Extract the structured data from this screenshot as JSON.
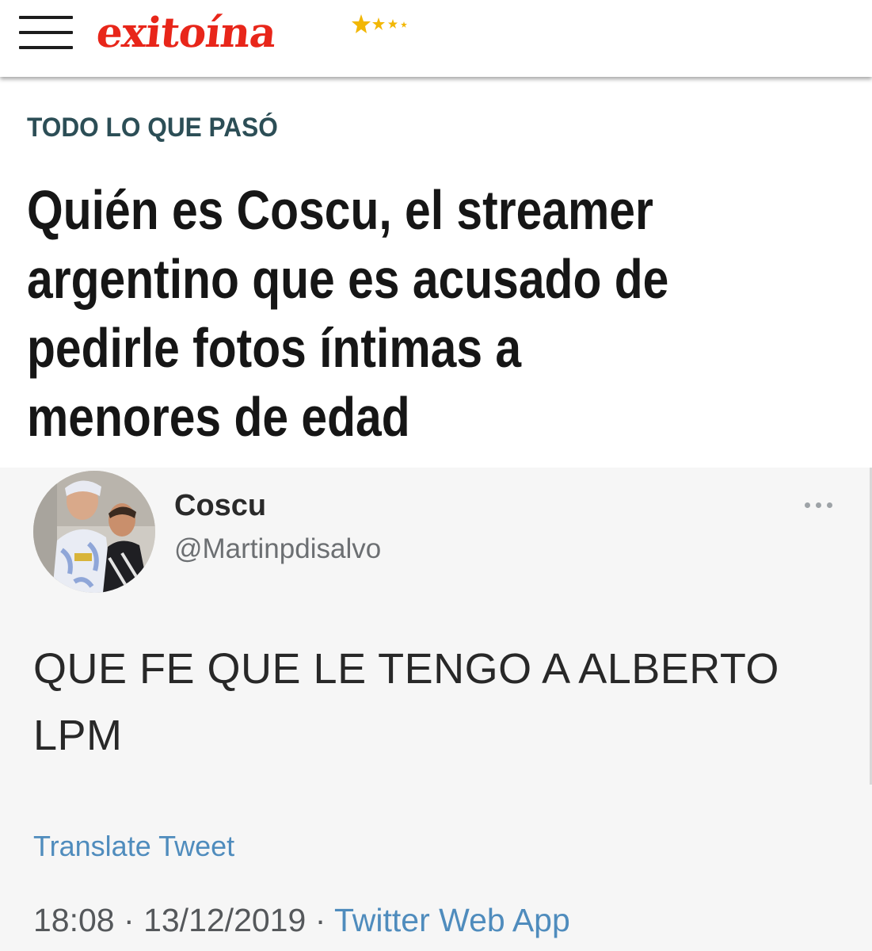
{
  "header": {
    "logo_text": "exitoína",
    "brand_color": "#e8261a",
    "star_color": "#f2b705",
    "menu_icon": "hamburger-menu-icon"
  },
  "article": {
    "kicker": "TODO LO QUE PASÓ",
    "kicker_color": "#2c4e56",
    "headline_lines": [
      "Quién es Coscu, el streamer",
      "argentino que es acusado de",
      "pedirle fotos íntimas a",
      "menores de edad"
    ]
  },
  "tweet": {
    "display_name": "Coscu",
    "handle": "@Martinpdisalvo",
    "more_icon": "more-options-icon",
    "text_lines": [
      "QUE FE QUE LE TENGO A ALBERTO",
      "LPM"
    ],
    "translate_label": "Translate Tweet",
    "time": "18:08",
    "separator": "·",
    "date": "13/12/2019",
    "source": "Twitter Web App",
    "link_color": "#4f8cbd"
  }
}
